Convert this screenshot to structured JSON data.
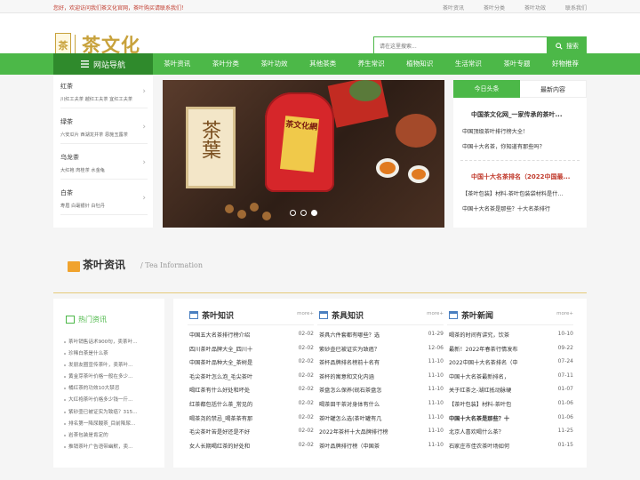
{
  "topbar": {
    "welcome": "您好，欢迎访问我们茶文化官网，茶叶购买请联系我们！",
    "links": [
      "茶叶资讯",
      "茶叶分类",
      "茶叶功效",
      "联系我们"
    ]
  },
  "header": {
    "logo_box": "茶",
    "logo_text": "茶文化",
    "logo_sub": "chawenhua",
    "search_placeholder": "请在这里搜索...",
    "search_button": "搜索"
  },
  "nav": {
    "home": "网站导航",
    "items": [
      "茶叶资讯",
      "茶叶分类",
      "茶叶功效",
      "其他茶类",
      "养生常识",
      "植物知识",
      "生活常识",
      "茶叶专题",
      "好物推荐"
    ]
  },
  "categories": [
    {
      "title": "红茶",
      "sub": "川红工夫茶  越红工夫茶  宜红工夫茶"
    },
    {
      "title": "绿茶",
      "sub": "六安瓜片  西湖龙井茶  恩施玉露茶"
    },
    {
      "title": "乌龙茶",
      "sub": "大红袍  肉桂茶  水金龟"
    },
    {
      "title": "白茶",
      "sub": "寿眉  白毫银针  白牡丹"
    }
  ],
  "banner": {
    "card_text": "茶葉",
    "can_label": "茶文化網",
    "dots": [
      false,
      false,
      true
    ]
  },
  "headlines": {
    "tab_active": "今日头条",
    "tab_other": "最新内容",
    "block1_title": "中国茶文化网_一家传承的茶叶...",
    "block1_lines": [
      "中国顶级茶叶排行榜大全！",
      "中国十大名茶，你知道有那些吗？"
    ],
    "block2_title": "中国十大名茶排名（2022中国最...",
    "block2_lines": [
      "【茶叶包装】材料-茶叶包装袋材料是什...",
      "中国十大名茶是那些？十大名茶排行"
    ]
  },
  "news_section": {
    "title": "茶叶资讯",
    "subtitle": "/ Tea Information"
  },
  "hot": {
    "title": "热门资讯",
    "items": [
      "茶叶销售话术900句，卖茶叶...",
      "珍稀白茶是什么茶",
      "发朋友圈宣传茶叶，卖茶叶...",
      "黄金芽茶叶价格一般在多少...",
      "橘红茶的功效10大禁忌",
      "大红袍茶叶价格多少钱一斤...",
      "紫砂壶已被证实为致癌？315...",
      "排名第一降尿酸茶_目前降尿...",
      "岩茶包装是肯定的",
      "推销茶叶广告语带幽默，卖..."
    ]
  },
  "columns": [
    {
      "title": "茶叶知识",
      "more": "more+",
      "rows": [
        {
          "t": "中国五大名茶排行榜介绍",
          "d": "02-02"
        },
        {
          "t": "四川茶叶品牌大全_四川十",
          "d": "02-02"
        },
        {
          "t": "中国茶叶品种大全_茶树是",
          "d": "02-02"
        },
        {
          "t": "毛尖茶叶怎么泡_毛尖茶叶",
          "d": "02-02"
        },
        {
          "t": "喝红茶有什么好处和坏处",
          "d": "02-02"
        },
        {
          "t": "红茶都包括什么茶_常见的",
          "d": "02-02"
        },
        {
          "t": "喝茶尧的禁忌_喝茶茶有那",
          "d": "02-02"
        },
        {
          "t": "毛尖茶叶苦是好还是不好",
          "d": "02-02"
        },
        {
          "t": "女人长期喝红茶的好处和",
          "d": "02-02"
        }
      ]
    },
    {
      "title": "茶具知识",
      "more": "more+",
      "rows": [
        {
          "t": "茶具六件套都有哪些？选",
          "d": "01-29"
        },
        {
          "t": "紫砂壶已被证实为致癌？",
          "d": "12-06"
        },
        {
          "t": "茶杯品牌排名榜前十名有",
          "d": "11-10"
        },
        {
          "t": "茶杯的寓意和文化内涵",
          "d": "11-10"
        },
        {
          "t": "茶盘怎么保养(砚石茶盘怎",
          "d": "11-10"
        },
        {
          "t": "喝茶田干茶对身体有什么",
          "d": "11-10"
        },
        {
          "t": "茶叶罐怎么选(茶叶罐有几",
          "d": "11-10"
        },
        {
          "t": "2022年茶杯十大品牌排行榜",
          "d": "11-10"
        },
        {
          "t": "茶叶品牌排行榜（中国茶",
          "d": "11-10"
        }
      ]
    },
    {
      "title": "茶叶新闻",
      "more": "more+",
      "rows": [
        {
          "t": "喝茶的时间有讲究，饮茶",
          "d": "10-10",
          "hl": false
        },
        {
          "t": "最新！2022年春茶行情发布",
          "d": "09-22",
          "hl": false
        },
        {
          "t": "2022中国十大名茶排名（中",
          "d": "07-24",
          "hl": false
        },
        {
          "t": "中国十大名茶最新排名，",
          "d": "07-11",
          "hl": false
        },
        {
          "t": "关于红茶之-湖红抵动脉硬",
          "d": "01-07",
          "hl": false
        },
        {
          "t": "【茶叶包装】材料-茶叶包",
          "d": "01-06",
          "hl": false
        },
        {
          "t": "中国十大名茶是那些？十",
          "d": "01-06",
          "hl": true
        },
        {
          "t": "北京人喜欢喝什么茶？",
          "d": "11-25",
          "hl": false
        },
        {
          "t": "石家庄市佳农茶叶场如何",
          "d": "01-15",
          "hl": false
        }
      ]
    }
  ],
  "colors": {
    "green": "#4cb848",
    "dark_green": "#2f8a2c",
    "gold": "#c8a23c",
    "red": "#c0392b"
  }
}
